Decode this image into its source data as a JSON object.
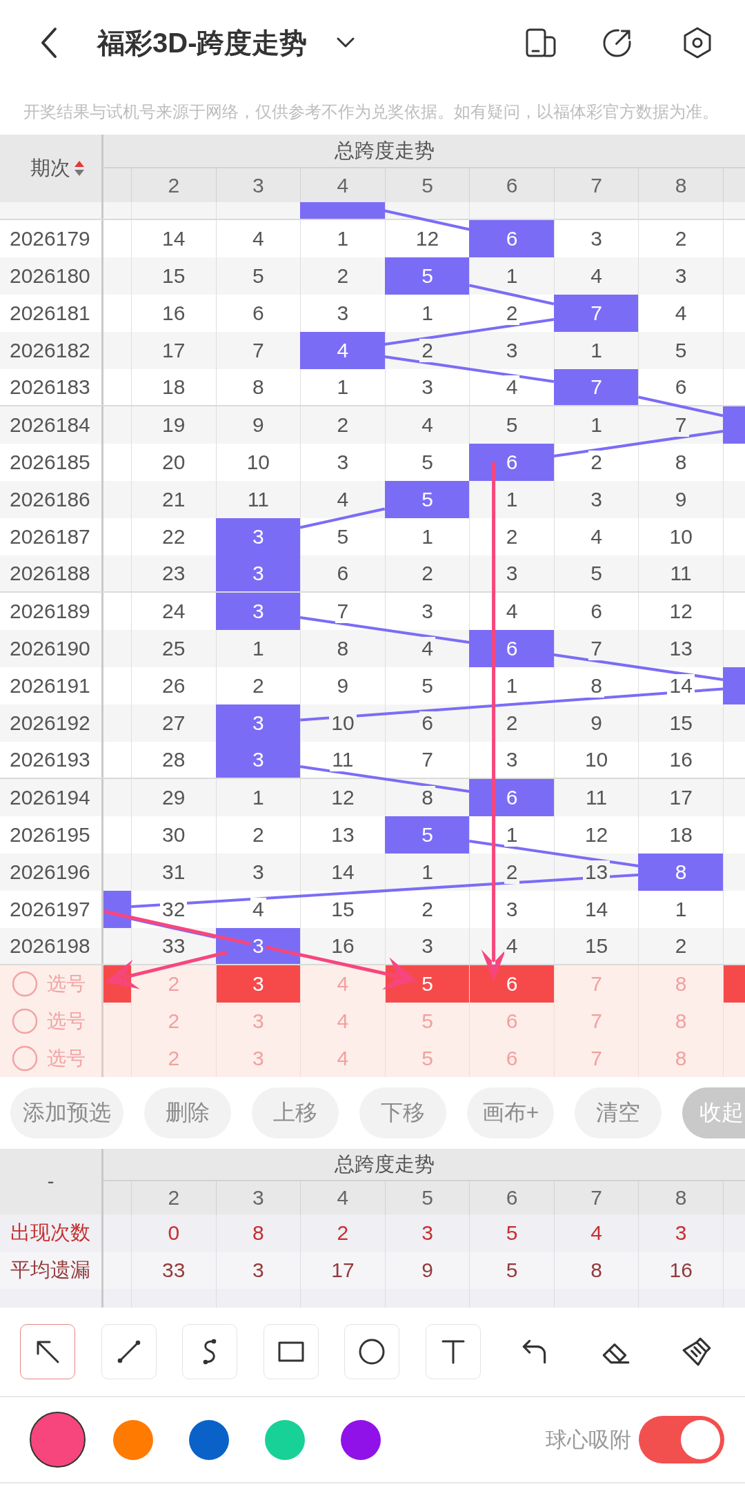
{
  "header": {
    "title": "福彩3D-跨度走势"
  },
  "notice": "开奖结果与试机号来源于网络，仅供参考不作为兑奖依据。如有疑问，以福体彩官方数据为准。",
  "trend_table": {
    "issue_header": "期次",
    "sort_ascending": true,
    "group_title": "总跨度走势",
    "columns": [
      "2",
      "3",
      "4",
      "5",
      "6",
      "7",
      "8"
    ],
    "rows": [
      {
        "kind": "clipped",
        "edge_left_hit": false,
        "hits": [
          false,
          false,
          true,
          false,
          false,
          false,
          false
        ],
        "edge_right_hit": false
      },
      {
        "kind": "full",
        "issue": "2026179",
        "cells": [
          "14",
          "4",
          "1",
          "12",
          "6",
          "3",
          "2"
        ],
        "edge_left_hit": false,
        "hits": [
          false,
          false,
          false,
          false,
          true,
          false,
          false
        ],
        "edge_right_hit": false
      },
      {
        "kind": "full",
        "issue": "2026180",
        "cells": [
          "15",
          "5",
          "2",
          "5",
          "1",
          "4",
          "3"
        ],
        "edge_left_hit": false,
        "hits": [
          false,
          false,
          false,
          true,
          false,
          false,
          false
        ],
        "edge_right_hit": false
      },
      {
        "kind": "full",
        "issue": "2026181",
        "cells": [
          "16",
          "6",
          "3",
          "1",
          "2",
          "7",
          "4"
        ],
        "edge_left_hit": false,
        "hits": [
          false,
          false,
          false,
          false,
          false,
          true,
          false
        ],
        "edge_right_hit": false
      },
      {
        "kind": "full",
        "issue": "2026182",
        "cells": [
          "17",
          "7",
          "4",
          "2",
          "3",
          "1",
          "5"
        ],
        "edge_left_hit": false,
        "hits": [
          false,
          false,
          true,
          false,
          false,
          false,
          false
        ],
        "edge_right_hit": false
      },
      {
        "kind": "full",
        "issue": "2026183",
        "cells": [
          "18",
          "8",
          "1",
          "3",
          "4",
          "7",
          "6"
        ],
        "edge_left_hit": false,
        "hits": [
          false,
          false,
          false,
          false,
          false,
          true,
          false
        ],
        "edge_right_hit": false
      },
      {
        "kind": "full",
        "issue": "2026184",
        "cells": [
          "19",
          "9",
          "2",
          "4",
          "5",
          "1",
          "7"
        ],
        "edge_left_hit": false,
        "hits": [
          false,
          false,
          false,
          false,
          false,
          false,
          false
        ],
        "edge_right_hit": true
      },
      {
        "kind": "full",
        "issue": "2026185",
        "cells": [
          "20",
          "10",
          "3",
          "5",
          "6",
          "2",
          "8"
        ],
        "edge_left_hit": false,
        "hits": [
          false,
          false,
          false,
          false,
          true,
          false,
          false
        ],
        "edge_right_hit": false
      },
      {
        "kind": "full",
        "issue": "2026186",
        "cells": [
          "21",
          "11",
          "4",
          "5",
          "1",
          "3",
          "9"
        ],
        "edge_left_hit": false,
        "hits": [
          false,
          false,
          false,
          true,
          false,
          false,
          false
        ],
        "edge_right_hit": false
      },
      {
        "kind": "full",
        "issue": "2026187",
        "cells": [
          "22",
          "3",
          "5",
          "1",
          "2",
          "4",
          "10"
        ],
        "edge_left_hit": false,
        "hits": [
          false,
          true,
          false,
          false,
          false,
          false,
          false
        ],
        "edge_right_hit": false
      },
      {
        "kind": "full",
        "issue": "2026188",
        "cells": [
          "23",
          "3",
          "6",
          "2",
          "3",
          "5",
          "11"
        ],
        "edge_left_hit": false,
        "hits": [
          false,
          true,
          false,
          false,
          false,
          false,
          false
        ],
        "edge_right_hit": false
      },
      {
        "kind": "full",
        "issue": "2026189",
        "cells": [
          "24",
          "3",
          "7",
          "3",
          "4",
          "6",
          "12"
        ],
        "edge_left_hit": false,
        "hits": [
          false,
          true,
          false,
          false,
          false,
          false,
          false
        ],
        "edge_right_hit": false
      },
      {
        "kind": "full",
        "issue": "2026190",
        "cells": [
          "25",
          "1",
          "8",
          "4",
          "6",
          "7",
          "13"
        ],
        "edge_left_hit": false,
        "hits": [
          false,
          false,
          false,
          false,
          true,
          false,
          false
        ],
        "edge_right_hit": false
      },
      {
        "kind": "full",
        "issue": "2026191",
        "cells": [
          "26",
          "2",
          "9",
          "5",
          "1",
          "8",
          "14"
        ],
        "edge_left_hit": false,
        "hits": [
          false,
          false,
          false,
          false,
          false,
          false,
          false
        ],
        "edge_right_hit": true
      },
      {
        "kind": "full",
        "issue": "2026192",
        "cells": [
          "27",
          "3",
          "10",
          "6",
          "2",
          "9",
          "15"
        ],
        "edge_left_hit": false,
        "hits": [
          false,
          true,
          false,
          false,
          false,
          false,
          false
        ],
        "edge_right_hit": false
      },
      {
        "kind": "full",
        "issue": "2026193",
        "cells": [
          "28",
          "3",
          "11",
          "7",
          "3",
          "10",
          "16"
        ],
        "edge_left_hit": false,
        "hits": [
          false,
          true,
          false,
          false,
          false,
          false,
          false
        ],
        "edge_right_hit": false
      },
      {
        "kind": "full",
        "issue": "2026194",
        "cells": [
          "29",
          "1",
          "12",
          "8",
          "6",
          "11",
          "17"
        ],
        "edge_left_hit": false,
        "hits": [
          false,
          false,
          false,
          false,
          true,
          false,
          false
        ],
        "edge_right_hit": false
      },
      {
        "kind": "full",
        "issue": "2026195",
        "cells": [
          "30",
          "2",
          "13",
          "5",
          "1",
          "12",
          "18"
        ],
        "edge_left_hit": false,
        "hits": [
          false,
          false,
          false,
          true,
          false,
          false,
          false
        ],
        "edge_right_hit": false
      },
      {
        "kind": "full",
        "issue": "2026196",
        "cells": [
          "31",
          "3",
          "14",
          "1",
          "2",
          "13",
          "8"
        ],
        "edge_left_hit": false,
        "hits": [
          false,
          false,
          false,
          false,
          false,
          false,
          true
        ],
        "edge_right_hit": false
      },
      {
        "kind": "full",
        "issue": "2026197",
        "cells": [
          "32",
          "4",
          "15",
          "2",
          "3",
          "14",
          "1"
        ],
        "edge_left_hit": true,
        "hits": [
          false,
          false,
          false,
          false,
          false,
          false,
          false
        ],
        "edge_right_hit": false
      },
      {
        "kind": "full",
        "issue": "2026198",
        "cells": [
          "33",
          "3",
          "16",
          "3",
          "4",
          "15",
          "2"
        ],
        "edge_left_hit": false,
        "hits": [
          false,
          true,
          false,
          false,
          false,
          false,
          false
        ],
        "edge_right_hit": false
      }
    ],
    "pick_rows": [
      {
        "label": "选号",
        "checked": false,
        "edge_left_pick": true,
        "cells": [
          "2",
          "3",
          "4",
          "5",
          "6",
          "7",
          "8"
        ],
        "picks": [
          false,
          true,
          false,
          true,
          true,
          false,
          false
        ],
        "edge_right_pick": true
      },
      {
        "label": "选号",
        "checked": false,
        "edge_left_pick": false,
        "cells": [
          "2",
          "3",
          "4",
          "5",
          "6",
          "7",
          "8"
        ],
        "picks": [
          false,
          false,
          false,
          false,
          false,
          false,
          false
        ],
        "edge_right_pick": false
      },
      {
        "label": "选号",
        "checked": false,
        "edge_left_pick": false,
        "cells": [
          "2",
          "3",
          "4",
          "5",
          "6",
          "7",
          "8"
        ],
        "picks": [
          false,
          false,
          false,
          false,
          false,
          false,
          false
        ],
        "edge_right_pick": false
      }
    ]
  },
  "canvas": {
    "strokes": [
      {
        "kind": "arrow"
      },
      {
        "kind": "arrow"
      },
      {
        "kind": "arrow"
      }
    ]
  },
  "actions": [
    {
      "label": "添加预选",
      "kind": "plain"
    },
    {
      "label": "删除",
      "kind": "plain"
    },
    {
      "label": "上移",
      "kind": "plain"
    },
    {
      "label": "下移",
      "kind": "plain"
    },
    {
      "label": "画布+",
      "kind": "plain"
    },
    {
      "label": "清空",
      "kind": "plain"
    },
    {
      "label": "收起",
      "kind": "filled"
    }
  ],
  "stats_table": {
    "corner": "-",
    "group_title": "总跨度走势",
    "columns": [
      "2",
      "3",
      "4",
      "5",
      "6",
      "7",
      "8"
    ],
    "rows": [
      {
        "label": "出现次数",
        "color": "#c62f2f",
        "values": [
          "0",
          "8",
          "2",
          "3",
          "5",
          "4",
          "3"
        ]
      },
      {
        "label": "平均遗漏",
        "color": "#933b3b",
        "values": [
          "33",
          "3",
          "17",
          "9",
          "5",
          "8",
          "16"
        ]
      }
    ]
  },
  "tools": [
    {
      "kind": "arrow",
      "selected": true
    },
    {
      "kind": "line",
      "selected": false
    },
    {
      "kind": "curve",
      "selected": false
    },
    {
      "kind": "rectangle",
      "selected": false
    },
    {
      "kind": "circle",
      "selected": false
    },
    {
      "kind": "text",
      "selected": false
    }
  ],
  "tool_actions": [
    {
      "kind": "undo"
    },
    {
      "kind": "eraser"
    },
    {
      "kind": "brush"
    }
  ],
  "palette": [
    {
      "color": "#f7467d",
      "selected": true
    },
    {
      "color": "#ff7a00",
      "selected": false
    },
    {
      "color": "#0a62c9",
      "selected": false
    },
    {
      "color": "#18d196",
      "selected": false
    },
    {
      "color": "#9012e8",
      "selected": false
    }
  ],
  "snap": {
    "label": "球心吸附",
    "on": true
  }
}
